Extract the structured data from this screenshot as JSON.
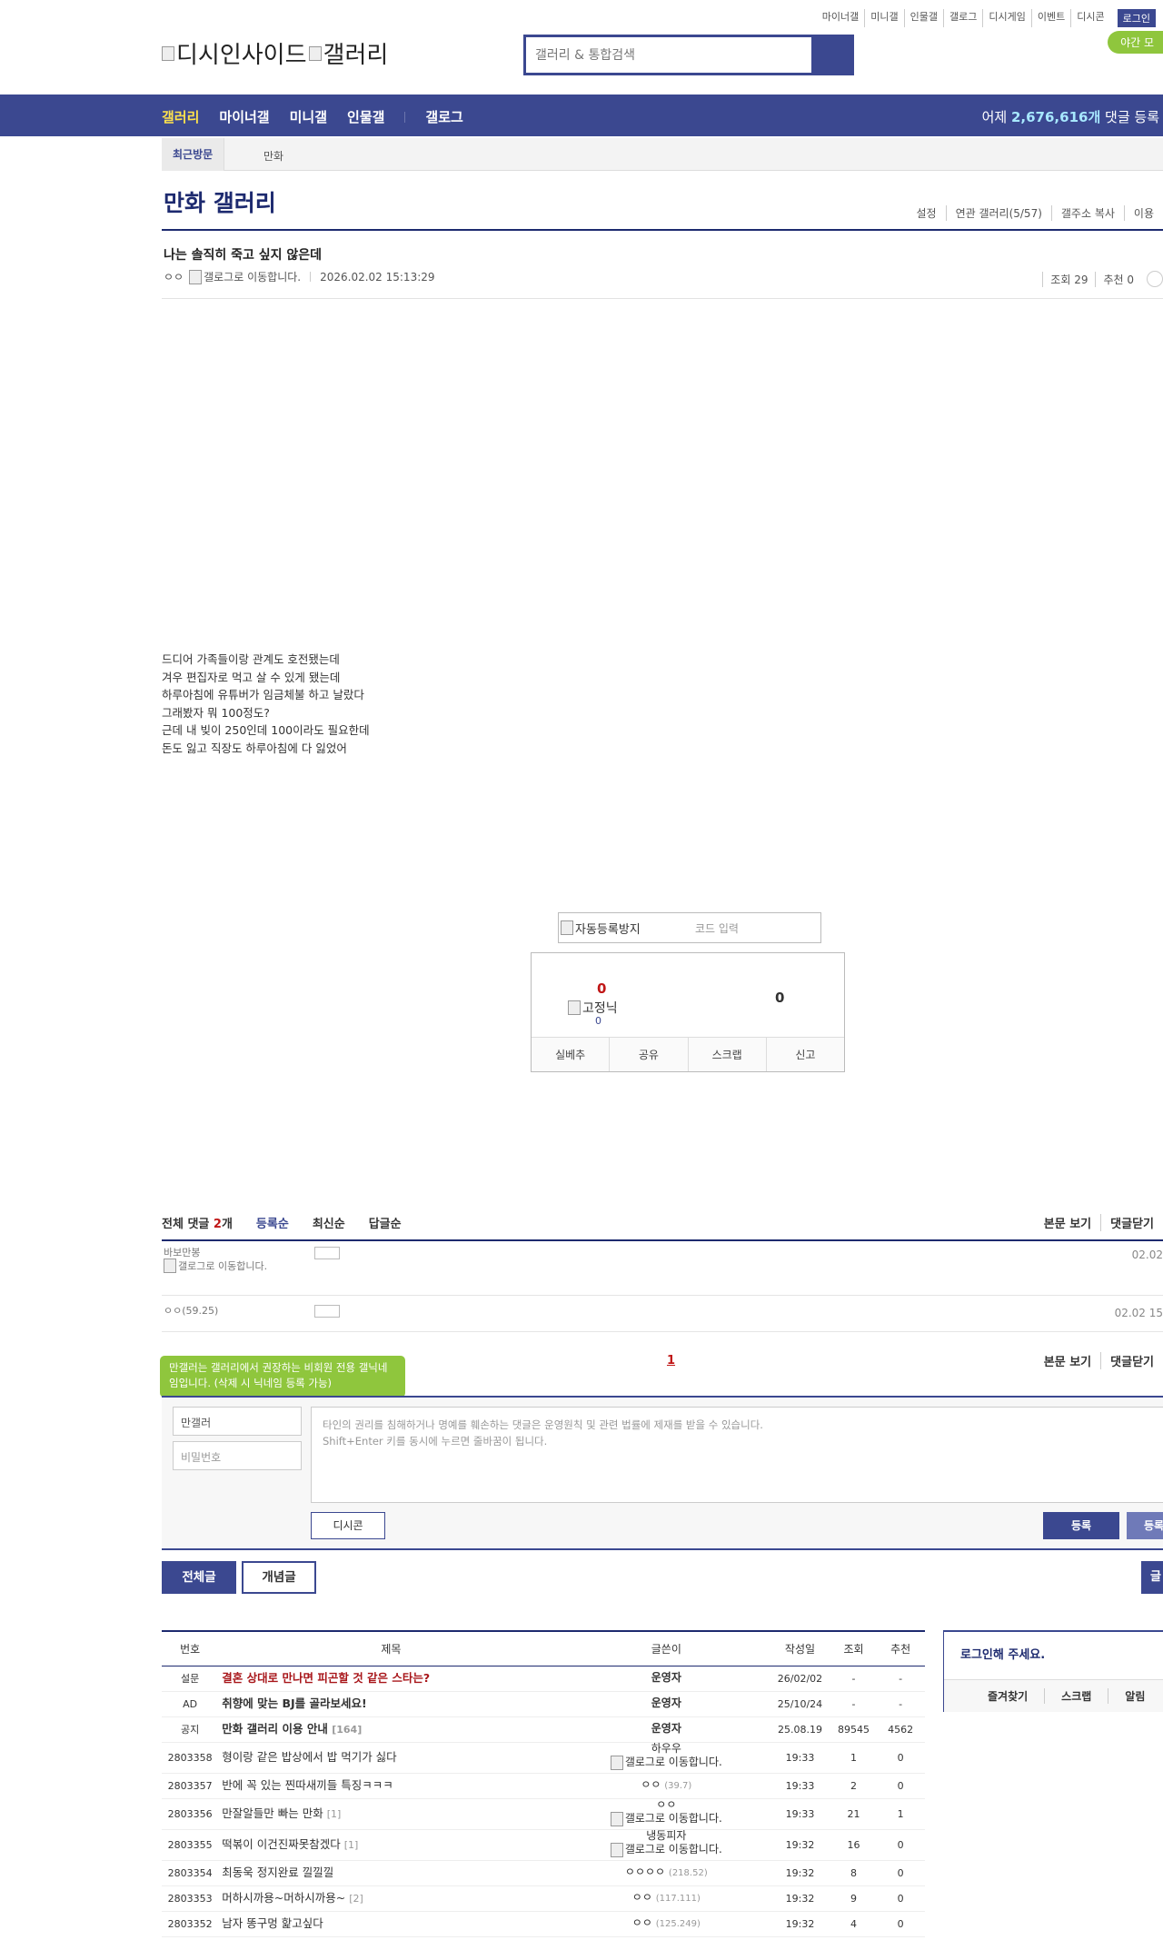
{
  "top_links": [
    "마이너갤",
    "미니갤",
    "인물갤",
    "갤로그",
    "디시게임",
    "이벤트",
    "디시콘"
  ],
  "login_label": "로그인",
  "night_label": "야간 모",
  "logo": {
    "site": "디시인사이드",
    "gallery": "갤러리"
  },
  "search": {
    "placeholder": "갤러리 & 통합검색"
  },
  "nav": {
    "items": [
      "갤러리",
      "마이너갤",
      "미니갤",
      "인물갤",
      "갤로그"
    ],
    "yesterday": "어제",
    "count": "2,676,616개",
    "suffix": "댓글 등록"
  },
  "subnav": {
    "recent": "최근방문",
    "item": "만화"
  },
  "gallery": {
    "title": "만화 갤러리",
    "links": [
      "설정",
      "연관 갤러리(5/57)",
      "갤주소 복사",
      "이용"
    ]
  },
  "post": {
    "title": "나는 솔직히 죽고 싶지 않은데",
    "author": "ㅇㅇ",
    "author_img_alt": "갤로그로 이동합니다.",
    "date": "2026.02.02 15:13:29",
    "views": "조회 29",
    "recommend": "추천 0",
    "body": [
      "드디어 가족들이랑 관계도 호전됐는데",
      "겨우 편집자로 먹고 살 수 있게 됐는데",
      "하루아침에 유튜버가 임금체불 하고 날랐다",
      "그래봤자 뭐 100정도?",
      "근데 내 빚이 250인데 100이라도 필요한데",
      "돈도 잃고 직장도 하루아침에 다 잃었어"
    ]
  },
  "captcha": {
    "img_alt": "자동등록방지",
    "placeholder": "코드 입력"
  },
  "vote": {
    "up": "0",
    "nick_alt": "고정닉",
    "fixed_count": "0",
    "down": "0",
    "buttons": [
      "실베추",
      "공유",
      "스크랩",
      "신고"
    ]
  },
  "comments": {
    "label": "전체 댓글",
    "count": "2",
    "unit": "개",
    "sorts": [
      "등록순",
      "최신순",
      "답글순"
    ],
    "right": [
      "본문 보기",
      "댓글닫기"
    ],
    "rows": [
      {
        "nick": "바보만봉",
        "nick_img": "갤로그로 이동합니다.",
        "img_alt": "ㅂㅂ",
        "date": "02.02"
      },
      {
        "nick": "ㅇㅇ(59.25)",
        "nick_img": "",
        "img_alt": "ㅅ",
        "date": "02.02 15"
      }
    ],
    "page": "1"
  },
  "write": {
    "tooltip": "만갤러는 갤러리에서 권장하는 비회원 전용 갤닉네임입니다. (삭제 시 닉네임 등록 가능)",
    "nick": "만갤러",
    "password": "비밀번호",
    "notice1": "타인의 권리를 침해하거나 명예를 훼손하는 댓글은 운영원칙 및 관련 법률에 제재를 받을 수 있습니다.",
    "notice2": "Shift+Enter 키를 동시에 누르면 줄바꿈이 됩니다.",
    "dccon": "디시콘",
    "submit": "등록",
    "submit2": "등록"
  },
  "list_tabs": {
    "all": "전체글",
    "concept": "개념글",
    "write": "글"
  },
  "list": {
    "headers": [
      "번호",
      "제목",
      "글쓴이",
      "작성일",
      "조회",
      "추천"
    ],
    "rows": [
      {
        "no": "설문",
        "title": "결혼 상대로 만나면 피곤할 것 같은 스타는?",
        "rc": "",
        "writer": "운영자",
        "ip": "",
        "date": "26/02/02",
        "views": "-",
        "rec": "-",
        "cls": "notice survey"
      },
      {
        "no": "AD",
        "title": "취향에 맞는 BJ를 골라보세요!",
        "rc": "",
        "writer": "운영자",
        "ip": "",
        "date": "25/10/24",
        "views": "-",
        "rec": "-",
        "cls": "notice"
      },
      {
        "no": "공지",
        "title": "만화 갤러리 이용 안내",
        "rc": "[164]",
        "writer": "운영자",
        "ip": "",
        "date": "25.08.19",
        "views": "89545",
        "rec": "4562",
        "cls": "notice"
      },
      {
        "no": "2803358",
        "title": "형이랑 같은 밥상에서 밥 먹기가 싫다",
        "rc": "",
        "writer": "하우우",
        "ip": "",
        "date": "19:33",
        "views": "1",
        "rec": "0",
        "cls": "tall",
        "img": "갤로그로 이동합니다."
      },
      {
        "no": "2803357",
        "title": "반에 꼭 있는 찐따새끼들 특징ㅋㅋㅋ",
        "rc": "",
        "writer": "ㅇㅇ",
        "ip": "(39.7)",
        "date": "19:33",
        "views": "2",
        "rec": "0",
        "cls": ""
      },
      {
        "no": "2803356",
        "title": "만잘알들만 빠는 만화",
        "rc": "[1]",
        "writer": "ㅇㅇ",
        "ip": "",
        "date": "19:33",
        "views": "21",
        "rec": "1",
        "cls": "tall",
        "img": "갤로그로 이동합니다."
      },
      {
        "no": "2803355",
        "title": "떡볶이 이건진짜못참겠다",
        "rc": "[1]",
        "writer": "냉동피자",
        "ip": "",
        "date": "19:32",
        "views": "16",
        "rec": "0",
        "cls": "tall",
        "img": "갤로그로 이동합니다."
      },
      {
        "no": "2803354",
        "title": "최동욱 정지완료 낄낄낄",
        "rc": "",
        "writer": "ㅇㅇㅇㅇ",
        "ip": "(218.52)",
        "date": "19:32",
        "views": "8",
        "rec": "0",
        "cls": ""
      },
      {
        "no": "2803353",
        "title": "머하시까용~머하시까용~",
        "rc": "[2]",
        "writer": "ㅇㅇ",
        "ip": "(117.111)",
        "date": "19:32",
        "views": "9",
        "rec": "0",
        "cls": ""
      },
      {
        "no": "2803352",
        "title": "남자 똥구멍 핥고싶다",
        "rc": "",
        "writer": "ㅇㅇ",
        "ip": "(125.249)",
        "date": "19:32",
        "views": "4",
        "rec": "0",
        "cls": ""
      }
    ]
  },
  "login_panel": {
    "title": "로그인해 주세요.",
    "links": [
      "즐겨찾기",
      "스크랩",
      "알림"
    ]
  }
}
